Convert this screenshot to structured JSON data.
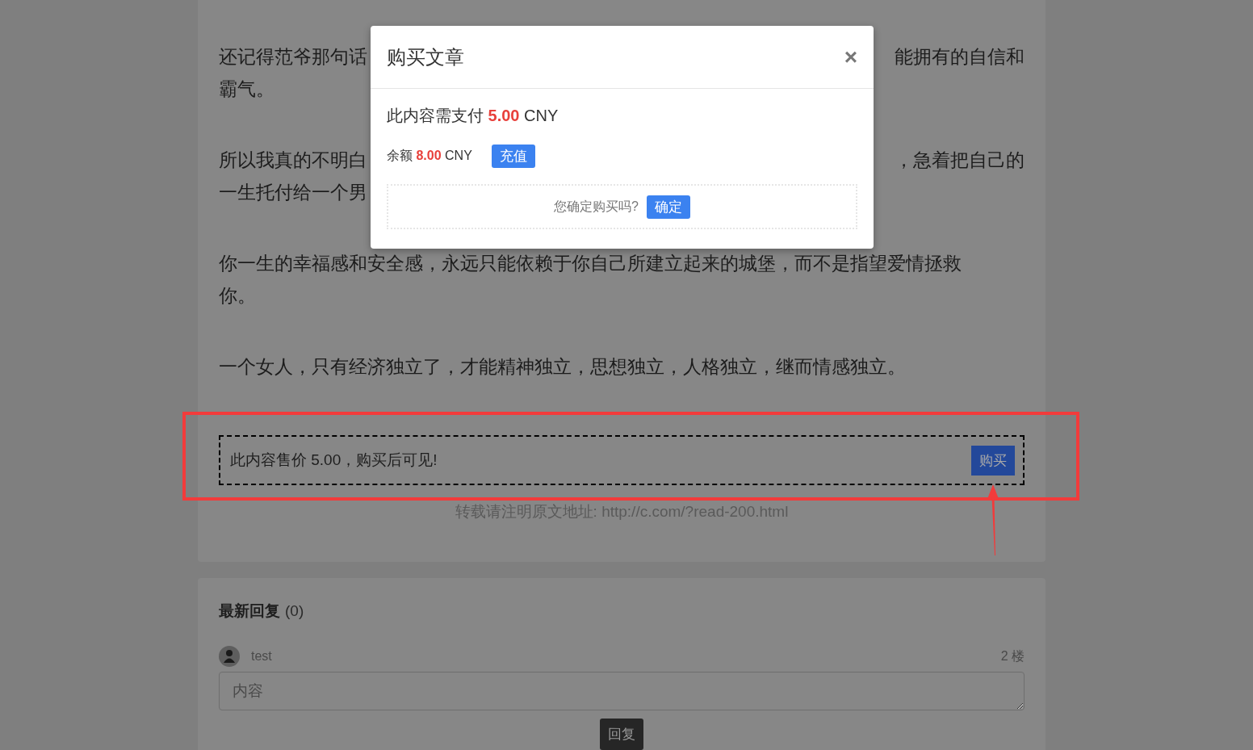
{
  "article": {
    "paragraphs": [
      {
        "lines": [
          {
            "left": "还记得范爷那句话",
            "right": "能拥有的自信和"
          },
          {
            "left": "霸气。"
          }
        ]
      },
      {
        "lines": [
          {
            "left": "所以我真的不明白",
            "right": "，急着把自己的"
          },
          {
            "left": "一生托付给一个男"
          }
        ]
      },
      {
        "lines": [
          {
            "left": "你一生的幸福感和安全感，永远只能依赖于你自己所建立起来的城堡，而不是指望爱情拯救"
          },
          {
            "left": "你。"
          }
        ]
      },
      {
        "lines": [
          {
            "left": "一个女人，只有经济独立了，才能精神独立，思想独立，人格独立，继而情感独立。"
          }
        ]
      }
    ]
  },
  "paywall": {
    "message": "此内容售价 5.00，购买后可见!",
    "button": "购买"
  },
  "source_note": "转载请注明原文地址: http://c.com/?read-200.html",
  "replies": {
    "title": "最新回复",
    "count": "(0)",
    "user": "test",
    "floor": "2 楼",
    "placeholder": "内容",
    "submit": "回复"
  },
  "modal": {
    "title": "购买文章",
    "close": "×",
    "price_label": "此内容需支付",
    "price": "5.00",
    "price_unit": "CNY",
    "balance_label": "余额",
    "balance": "8.00",
    "balance_unit": "CNY",
    "recharge": "充值",
    "confirm_question": "您确定购买吗?",
    "confirm": "确定"
  }
}
